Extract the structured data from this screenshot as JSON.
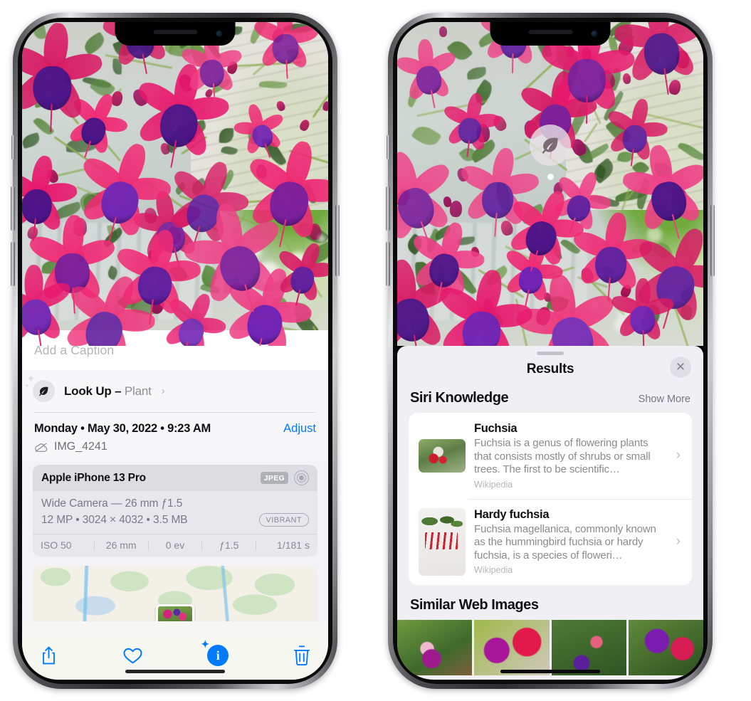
{
  "left_phone": {
    "caption": {
      "placeholder": "Add a Caption",
      "value": ""
    },
    "lookup": {
      "label": "Look Up – ",
      "subject": "Plant",
      "chevron": "›",
      "icon": "leaf-icon",
      "sparkle": "✦"
    },
    "meta": {
      "date": "Monday • May 30, 2022 • 9:23 AM",
      "adjust_label": "Adjust",
      "filename": "IMG_4241",
      "cloud_icon": "icloud-slash-icon"
    },
    "exif": {
      "device": "Apple iPhone 13 Pro",
      "format_badge": "JPEG",
      "aperture_icon": "aperture-icon",
      "lens": "Wide Camera — 26 mm ƒ1.5",
      "size_line": "12 MP • 3024 × 4032 • 3.5 MB",
      "style_badge": "VIBRANT",
      "stats": [
        "ISO 50",
        "26 mm",
        "0 ev",
        "ƒ1.5",
        "1/181 s"
      ]
    },
    "toolbar": {
      "share_label": "share-icon",
      "favorite_label": "heart-icon",
      "info_label": "info-icon",
      "delete_label": "trash-icon",
      "info_glyph": "i",
      "info_sparkle": "✦"
    }
  },
  "right_phone": {
    "vlu_badge_icon": "leaf-icon",
    "sheet": {
      "title": "Results",
      "close_label": "✕"
    },
    "siri_knowledge": {
      "title": "Siri Knowledge",
      "show_more": "Show More",
      "items": [
        {
          "title": "Fuchsia",
          "description": "Fuchsia is a genus of flowering plants that consists mostly of shrubs or small trees. The first to be scientific…",
          "source": "Wikipedia",
          "chevron": "›"
        },
        {
          "title": "Hardy fuchsia",
          "description": "Fuchsia magellanica, commonly known as the hummingbird fuchsia or hardy fuchsia, is a species of floweri…",
          "source": "Wikipedia",
          "chevron": "›"
        }
      ]
    },
    "similar_web_images": {
      "title": "Similar Web Images",
      "count": 4
    }
  },
  "colors": {
    "accent_blue": "#007aff",
    "sheet_bg": "#f0eff4",
    "card_bg": "#ffffff",
    "exif_bg": "#e7e7ec",
    "secondary_text": "#8a8a90"
  }
}
